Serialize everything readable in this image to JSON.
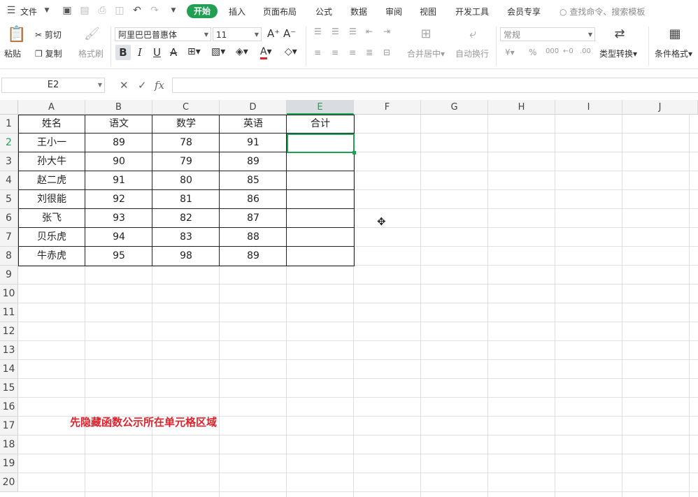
{
  "menu": {
    "file": "文件",
    "tabs": [
      "开始",
      "插入",
      "页面布局",
      "公式",
      "数据",
      "审阅",
      "视图",
      "开发工具",
      "会员专享"
    ],
    "search_placeholder": "查找命令、搜索模板"
  },
  "ribbon": {
    "paste": "粘贴",
    "cut": "剪切",
    "copy": "复制",
    "format_painter": "格式刷",
    "font_name": "阿里巴巴普惠体",
    "font_size": "11",
    "merge_center": "合并居中",
    "wrap_text": "自动换行",
    "number_format": "常规",
    "currency_symbol": "¥",
    "percent_symbol": "%",
    "thousands_symbol": "000",
    "type_convert": "类型转换",
    "conditional_format": "条件格式"
  },
  "formula_bar": {
    "name_box": "E2",
    "fx": "fx",
    "formula": ""
  },
  "grid": {
    "columns": [
      "A",
      "B",
      "C",
      "D",
      "E",
      "F",
      "G",
      "H",
      "I",
      "J"
    ],
    "selected_column": "E",
    "rows": [
      "1",
      "2",
      "3",
      "4",
      "5",
      "6",
      "7",
      "8",
      "9",
      "10",
      "11",
      "12",
      "13",
      "14",
      "15",
      "16",
      "17",
      "18",
      "19",
      "20"
    ],
    "selected_row": "2",
    "headers": [
      "姓名",
      "语文",
      "数学",
      "英语",
      "合计"
    ],
    "data": [
      [
        "王小一",
        "89",
        "78",
        "91",
        ""
      ],
      [
        "孙大牛",
        "90",
        "79",
        "89",
        ""
      ],
      [
        "赵二虎",
        "91",
        "80",
        "85",
        ""
      ],
      [
        "刘很能",
        "92",
        "81",
        "86",
        ""
      ],
      [
        "张飞",
        "93",
        "82",
        "87",
        ""
      ],
      [
        "贝乐虎",
        "94",
        "83",
        "88",
        ""
      ],
      [
        "牛赤虎",
        "95",
        "98",
        "89",
        ""
      ]
    ],
    "note": "先隐藏函数公示所在单元格区域"
  },
  "colors": {
    "accent": "#1fa053",
    "note": "#e0202a"
  }
}
